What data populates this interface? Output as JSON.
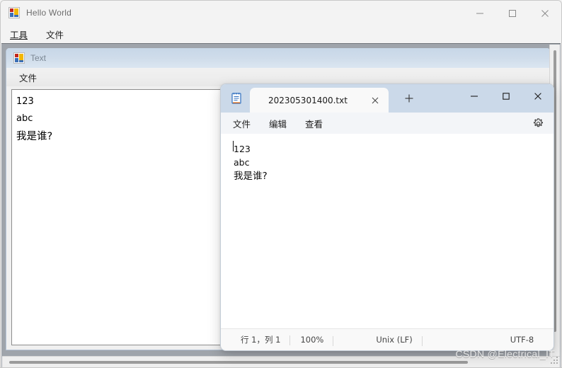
{
  "main_window": {
    "title": "Hello World",
    "icon": "winforms-icon",
    "menu": [
      {
        "label": "工具",
        "underlined": true
      },
      {
        "label": "文件",
        "underlined": false
      }
    ],
    "window_controls": [
      {
        "name": "minimize",
        "glyph": "minimize-icon"
      },
      {
        "name": "maximize",
        "glyph": "maximize-icon"
      },
      {
        "name": "close",
        "glyph": "close-icon"
      }
    ]
  },
  "mdi_child": {
    "title": "Text",
    "icon": "winforms-icon",
    "menu": [
      {
        "label": "文件"
      }
    ],
    "text_lines": [
      "123",
      "abc",
      "我是谁?"
    ]
  },
  "notepad": {
    "app_icon": "notepad-icon",
    "tab": {
      "label": "202305301400.txt",
      "close_label": "✕"
    },
    "new_tab_label": "+",
    "window_controls": [
      {
        "name": "minimize",
        "glyph": "minimize-icon"
      },
      {
        "name": "maximize",
        "glyph": "maximize-icon"
      },
      {
        "name": "close",
        "glyph": "close-icon"
      }
    ],
    "menu": [
      {
        "label": "文件"
      },
      {
        "label": "编辑"
      },
      {
        "label": "查看"
      }
    ],
    "settings_icon": "gear-icon",
    "text_lines": [
      "123",
      "abc",
      "我是谁?"
    ],
    "status": {
      "position": "行 1，列 1",
      "zoom": "100%",
      "line_ending": "Unix (LF)",
      "encoding": "UTF-8"
    }
  },
  "watermark": "CSDN @Electrical_IT",
  "colors": {
    "mdi_client_bg": "#9fa4ab",
    "mdi_child_title": "#cfdcea",
    "notepad_tabstrip": "#cbd9e9",
    "notepad_body": "#ffffff"
  }
}
